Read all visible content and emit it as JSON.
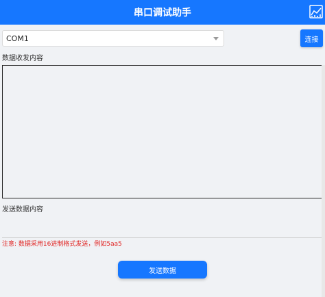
{
  "header": {
    "title": "串口调试助手",
    "icon": "chart-icon"
  },
  "port": {
    "selected": "COM1"
  },
  "buttons": {
    "connect": "连接",
    "send": "发送数据"
  },
  "receive": {
    "label": "数据收发内容",
    "content": ""
  },
  "send": {
    "label": "发送数据内容",
    "value": ""
  },
  "note": "注意: 数据采用16进制格式发送，例如5aa5",
  "colors": {
    "primary": "#1677ff",
    "warning": "#e0201e",
    "background": "#f0f2f5"
  }
}
